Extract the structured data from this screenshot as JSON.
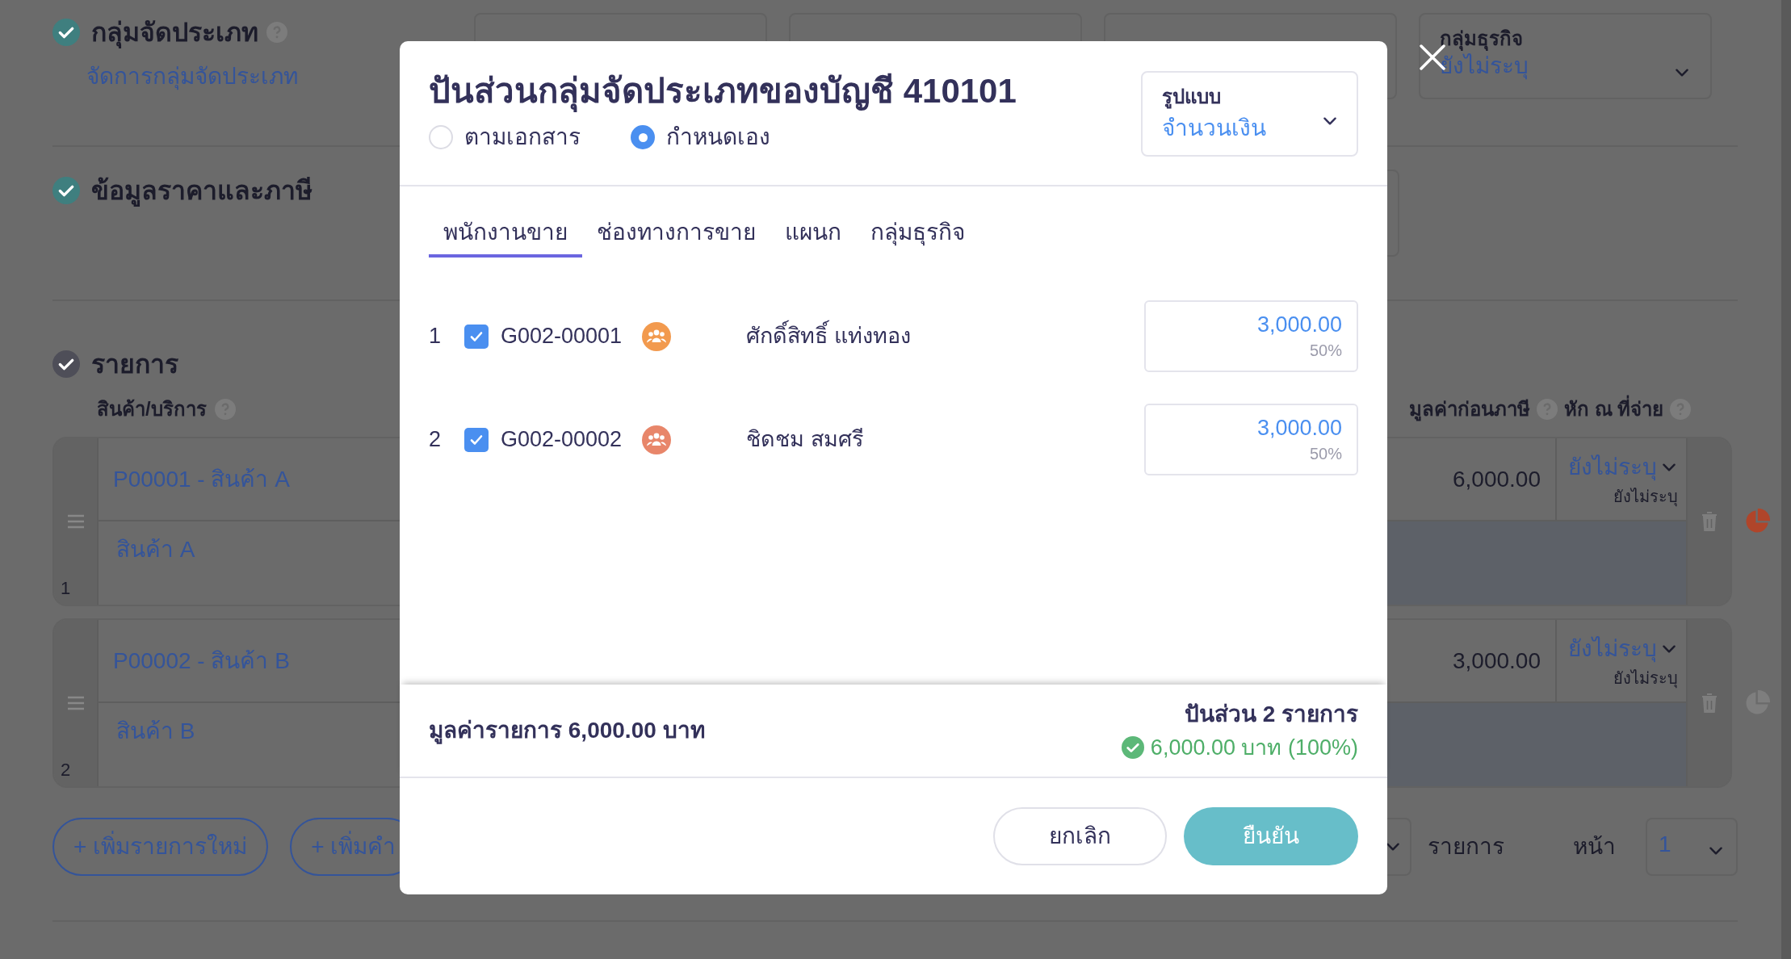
{
  "page": {
    "classification": {
      "title": "กลุ่มจัดประเภท",
      "done": true,
      "link": "จัดการกลุ่มจัดประเภท",
      "business_group": {
        "label": "กลุ่มธุรกิจ",
        "value": "ยังไม่ระบุ"
      }
    },
    "pricing": {
      "title": "ข้อมูลราคาและภาษี",
      "done": true
    },
    "items": {
      "title": "รายการ",
      "done": false,
      "columns": [
        "สินค้า/บริการ",
        "มูลค่าก่อนภาษี",
        "หัก ณ ที่จ่าย"
      ],
      "rows": [
        {
          "index": "1",
          "product": "P00001 - สินค้า A",
          "description": "สินค้า A",
          "amount": "6,000.00",
          "withholding": "ยังไม่ระบุ",
          "withholding_note": "ยังไม่ระบุ",
          "allocated": true
        },
        {
          "index": "2",
          "product": "P00002 - สินค้า B",
          "description": "สินค้า B",
          "amount": "3,000.00",
          "withholding": "ยังไม่ระบุ",
          "withholding_note": "ยังไม่ระบุ",
          "allocated": false
        }
      ],
      "buttons": [
        "+ เพิ่มรายการใหม่",
        "+ เพิ่มคำ"
      ],
      "pagination": {
        "label": "รายการ",
        "page_label": "หน้า",
        "page": "1"
      }
    }
  },
  "dialog": {
    "title": "ปันส่วนกลุ่มจัดประเภทของบัญชี 410101",
    "modes": [
      {
        "label": "ตามเอกสาร",
        "selected": false
      },
      {
        "label": "กำหนดเอง",
        "selected": true
      }
    ],
    "format": {
      "label": "รูปแบบ",
      "value": "จำนวนเงิน"
    },
    "tabs": [
      {
        "label": "พนักงานขาย",
        "selected": true
      },
      {
        "label": "ช่องทางการขาย",
        "selected": false
      },
      {
        "label": "แผนก",
        "selected": false
      },
      {
        "label": "กลุ่มธุรกิจ",
        "selected": false
      }
    ],
    "rows": [
      {
        "index": "1",
        "checked": true,
        "code": "G002-00001",
        "color": "#f29a4e",
        "name": "ศักดิ์สิทธิ์ แท่งทอง",
        "amount": "3,000.00",
        "percent": "50%"
      },
      {
        "index": "2",
        "checked": true,
        "code": "G002-00002",
        "color": "#e8866a",
        "name": "ชิดชม สมศรี",
        "amount": "3,000.00",
        "percent": "50%"
      }
    ],
    "total": "มูลค่ารายการ 6,000.00 บาท",
    "summary": "ปันส่วน 2 รายการ",
    "status": {
      "ok": true,
      "text": "6,000.00 บาท (100%)"
    },
    "buttons": [
      {
        "label": "ยกเลิก",
        "kind": "secondary"
      },
      {
        "label": "ยืนยัน",
        "kind": "primary"
      }
    ]
  }
}
